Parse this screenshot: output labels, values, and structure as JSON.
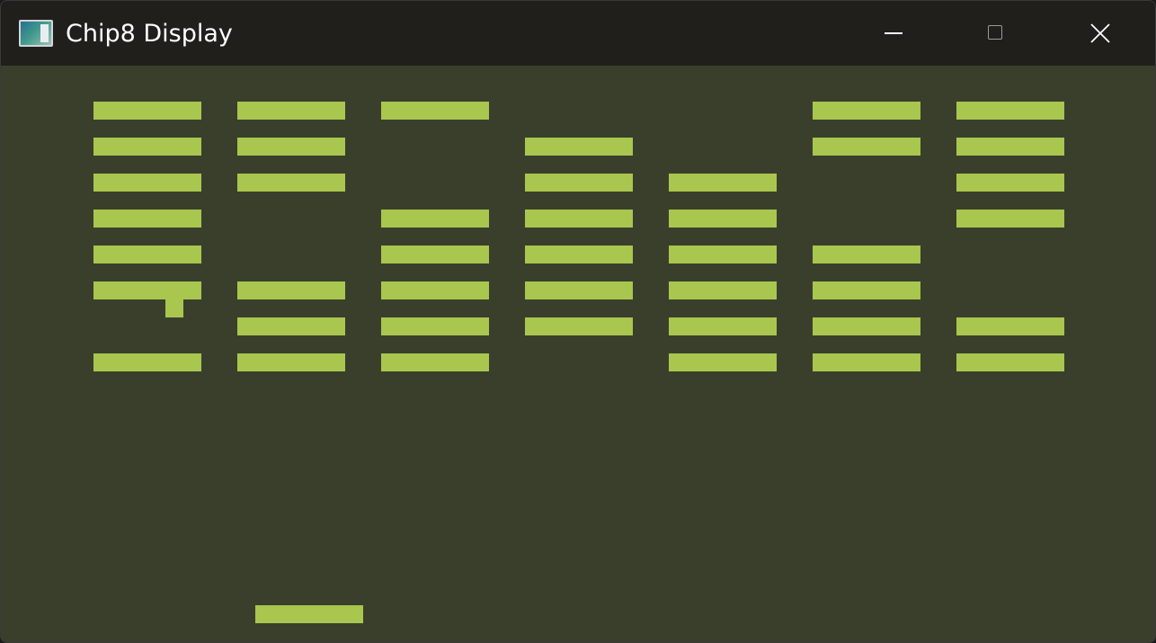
{
  "window": {
    "title": "Chip8 Display"
  },
  "colors": {
    "titlebar_bg": "#201f1b",
    "screen_bg": "#3a3f2c",
    "pixel_on": "#a9c64e",
    "title_text": "#ffffff"
  },
  "icons": {
    "app": "app-window-icon",
    "minimize": "minimize-icon",
    "maximize": "maximize-icon",
    "close": "close-icon"
  },
  "display": {
    "resolution": [
      64,
      32
    ],
    "bricks": [
      {
        "col": 5,
        "row": 2
      },
      {
        "col": 13,
        "row": 2
      },
      {
        "col": 21,
        "row": 2
      },
      {
        "col": 45,
        "row": 2
      },
      {
        "col": 53,
        "row": 2
      },
      {
        "col": 5,
        "row": 4
      },
      {
        "col": 13,
        "row": 4
      },
      {
        "col": 29,
        "row": 4
      },
      {
        "col": 45,
        "row": 4
      },
      {
        "col": 53,
        "row": 4
      },
      {
        "col": 5,
        "row": 6
      },
      {
        "col": 13,
        "row": 6
      },
      {
        "col": 29,
        "row": 6
      },
      {
        "col": 37,
        "row": 6
      },
      {
        "col": 53,
        "row": 6
      },
      {
        "col": 5,
        "row": 8
      },
      {
        "col": 21,
        "row": 8
      },
      {
        "col": 29,
        "row": 8
      },
      {
        "col": 37,
        "row": 8
      },
      {
        "col": 53,
        "row": 8
      },
      {
        "col": 5,
        "row": 10
      },
      {
        "col": 21,
        "row": 10
      },
      {
        "col": 29,
        "row": 10
      },
      {
        "col": 37,
        "row": 10
      },
      {
        "col": 45,
        "row": 10
      },
      {
        "col": 5,
        "row": 12
      },
      {
        "col": 13,
        "row": 12
      },
      {
        "col": 21,
        "row": 12
      },
      {
        "col": 29,
        "row": 12
      },
      {
        "col": 37,
        "row": 12
      },
      {
        "col": 45,
        "row": 12
      },
      {
        "col": 13,
        "row": 14
      },
      {
        "col": 21,
        "row": 14
      },
      {
        "col": 29,
        "row": 14
      },
      {
        "col": 37,
        "row": 14
      },
      {
        "col": 45,
        "row": 14
      },
      {
        "col": 53,
        "row": 14
      },
      {
        "col": 5,
        "row": 16
      },
      {
        "col": 13,
        "row": 16
      },
      {
        "col": 21,
        "row": 16
      },
      {
        "col": 37,
        "row": 16
      },
      {
        "col": 45,
        "row": 16
      },
      {
        "col": 53,
        "row": 16
      }
    ],
    "ball": {
      "col": 9,
      "row": 13
    },
    "paddle": {
      "col": 14,
      "row": 30
    }
  }
}
